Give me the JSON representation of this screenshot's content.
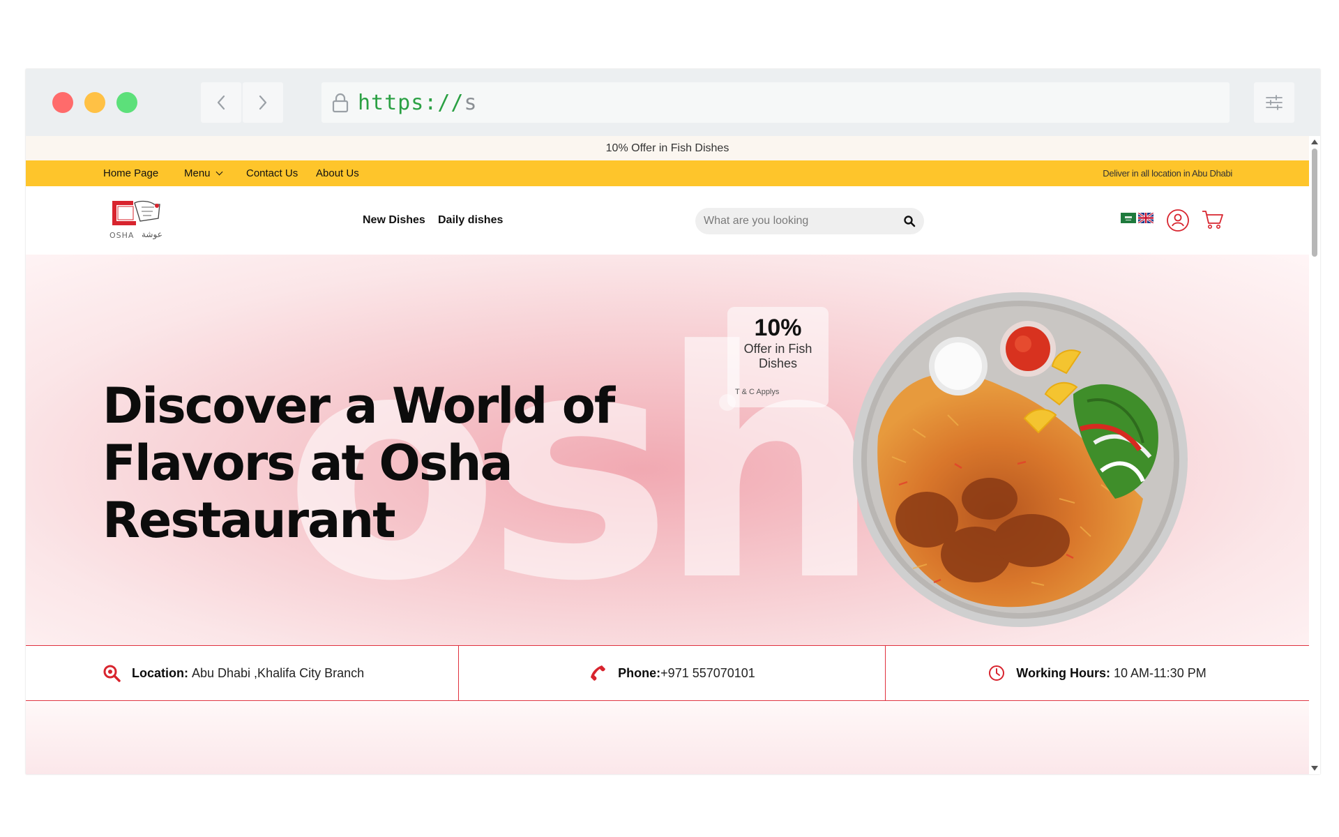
{
  "browser": {
    "url_scheme": "https://",
    "url_rest": "s"
  },
  "promo_bar": {
    "text": "10% Offer in Fish Dishes"
  },
  "top_nav": {
    "items": [
      {
        "label": "Home Page"
      },
      {
        "label": "Menu"
      },
      {
        "label": "Contact Us"
      },
      {
        "label": "About Us"
      }
    ],
    "delivery_note": "Deliver in all location in Abu Dhabi"
  },
  "header": {
    "logo_text_en": "OSHA",
    "logo_text_ar": "عوشة",
    "nav": [
      {
        "label": "New Dishes"
      },
      {
        "label": "Daily dishes"
      }
    ],
    "search_placeholder": "What are you looking",
    "icons": [
      "search-icon",
      "saudi-flag-icon",
      "uk-flag-icon",
      "user-icon",
      "cart-icon"
    ]
  },
  "hero": {
    "background_word": "osha",
    "headline": "Discover a World of Flavors at Osha Restaurant",
    "offer_card": {
      "percent": "10%",
      "text": "Offer in Fish Dishes",
      "terms": "T & C Applys"
    }
  },
  "info_strip": {
    "location_label": "Location:",
    "location_value": "Abu Dhabi ,Khalifa City Branch",
    "phone_label": "Phone:",
    "phone_value": "+971 557070101",
    "hours_label": "Working Hours:",
    "hours_value": "10 AM-11:30 PM"
  },
  "colors": {
    "accent_yellow": "#fec52b",
    "accent_red": "#e0313e",
    "hero_pink": "#f4b9c0"
  }
}
